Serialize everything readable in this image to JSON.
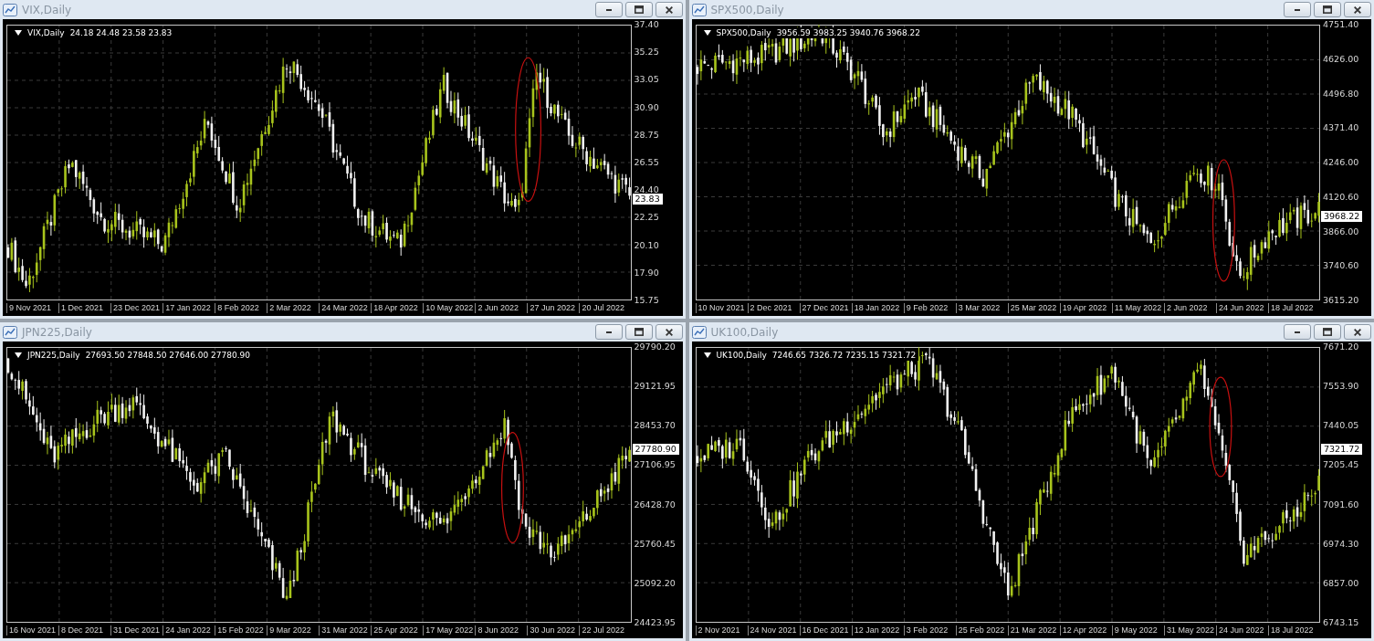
{
  "windows": [
    {
      "title": "VIX,Daily",
      "symbol": "VIX,Daily",
      "ohlc": "24.18 24.48 23.58 23.83",
      "current_price": "23.83",
      "price_ticks": [
        "37.40",
        "35.25",
        "33.05",
        "30.90",
        "28.75",
        "26.55",
        "24.40",
        "22.25",
        "20.10",
        "17.90",
        "15.75"
      ],
      "date_labels": [
        "9 Nov 2021",
        "1 Dec 2021",
        "23 Dec 2021",
        "17 Jan 2022",
        "8 Feb 2022",
        "2 Mar 2022",
        "24 Mar 2022",
        "18 Apr 2022",
        "10 May 2022",
        "2 Jun 2022",
        "27 Jun 2022",
        "20 Jul 2022"
      ]
    },
    {
      "title": "SPX500,Daily",
      "symbol": "SPX500,Daily",
      "ohlc": "3956.59 3983.25 3940.76 3968.22",
      "current_price": "3968.22",
      "price_ticks": [
        "4751.40",
        "4626.00",
        "4496.80",
        "4371.40",
        "4246.00",
        "4120.60",
        "3866.00",
        "3740.60",
        "3615.20"
      ],
      "date_labels": [
        "10 Nov 2021",
        "2 Dec 2021",
        "27 Dec 2021",
        "18 Jan 2022",
        "9 Feb 2022",
        "3 Mar 2022",
        "25 Mar 2022",
        "19 Apr 2022",
        "11 May 2022",
        "2 Jun 2022",
        "24 Jun 2022",
        "18 Jul 2022"
      ]
    },
    {
      "title": "JPN225,Daily",
      "symbol": "JPN225,Daily",
      "ohlc": "27693.50 27848.50 27646.00 27780.90",
      "current_price": "27780.90",
      "price_ticks": [
        "29790.20",
        "29121.95",
        "28453.70",
        "27106.95",
        "26428.70",
        "25760.45",
        "25092.20",
        "24423.95"
      ],
      "date_labels": [
        "16 Nov 2021",
        "8 Dec 2021",
        "31 Dec 2021",
        "24 Jan 2022",
        "15 Feb 2022",
        "9 Mar 2022",
        "31 Mar 2022",
        "25 Apr 2022",
        "17 May 2022",
        "8 Jun 2022",
        "30 Jun 2022",
        "22 Jul 2022"
      ]
    },
    {
      "title": "UK100,Daily",
      "symbol": "UK100,Daily",
      "ohlc": "7246.65 7326.72 7235.15 7321.72",
      "current_price": "7321.72",
      "price_ticks": [
        "7671.20",
        "7553.90",
        "7440.05",
        "7205.45",
        "7091.60",
        "6974.30",
        "6857.00",
        "6743.15"
      ],
      "date_labels": [
        "2 Nov 2021",
        "24 Nov 2021",
        "16 Dec 2021",
        "12 Jan 2022",
        "3 Feb 2022",
        "25 Feb 2022",
        "21 Mar 2022",
        "12 Apr 2022",
        "9 May 2022",
        "31 May 2022",
        "24 Jun 2022",
        "18 Jul 2022"
      ]
    }
  ]
}
